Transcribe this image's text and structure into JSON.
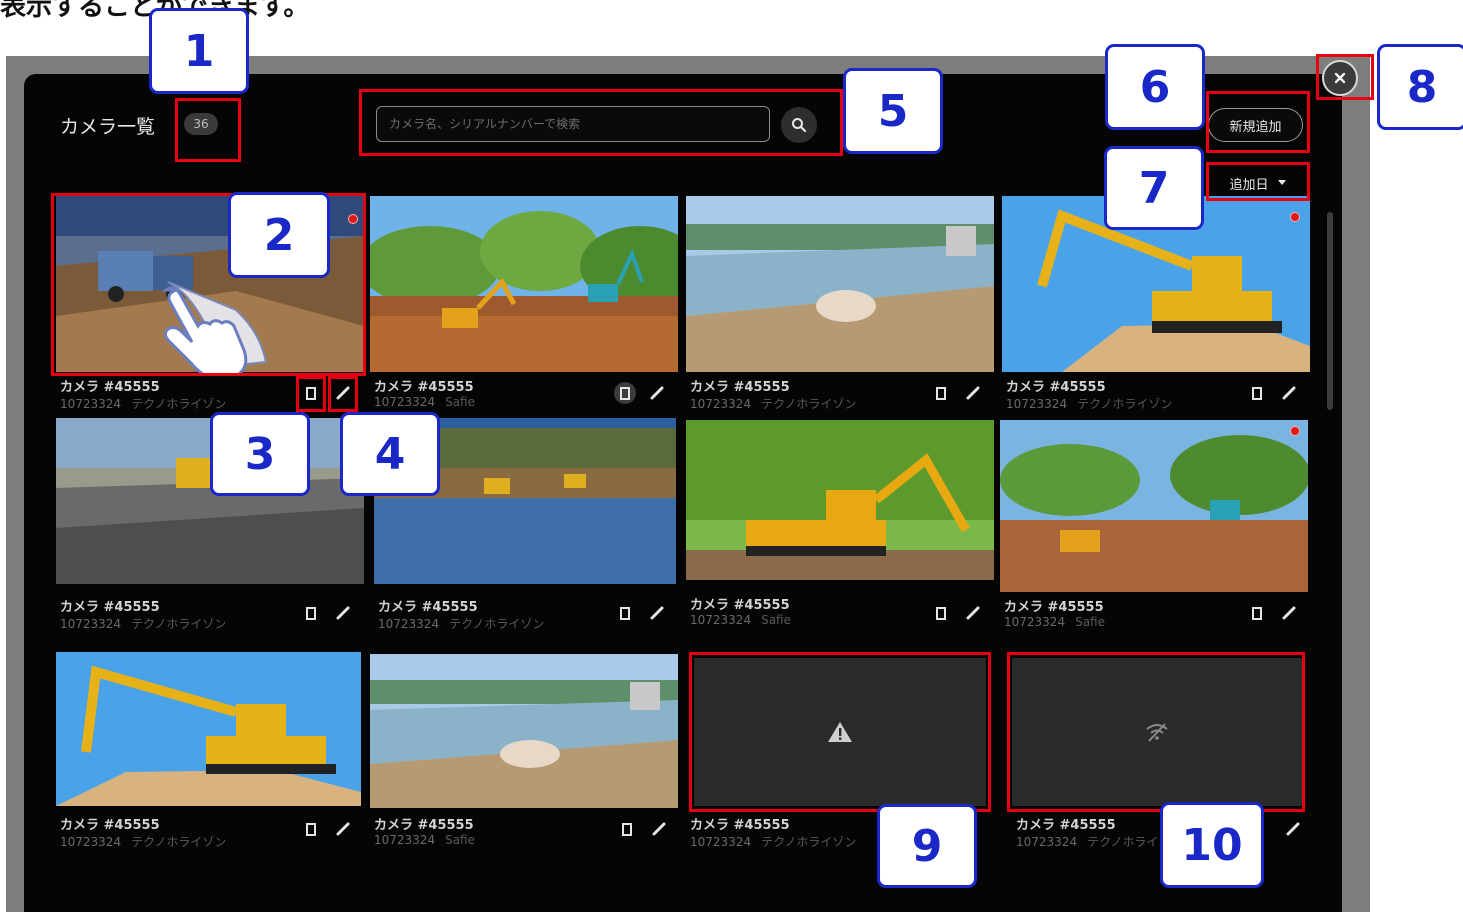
{
  "page_fragment": "表示することができます。",
  "header": {
    "title": "カメラ一覧",
    "count": "36",
    "search_placeholder": "カメラ名、シリアルナンバーで検索",
    "new_button": "新規追加",
    "sort_label": "追加日"
  },
  "cameras": [
    {
      "name": "カメラ #45555",
      "serial": "10723324",
      "source": "テクノホライゾン",
      "recording": true,
      "status": "image"
    },
    {
      "name": "カメラ #45555",
      "serial": "10723324",
      "source": "Safie",
      "recording": false,
      "status": "image"
    },
    {
      "name": "カメラ #45555",
      "serial": "10723324",
      "source": "テクノホライゾン",
      "recording": false,
      "status": "image"
    },
    {
      "name": "カメラ #45555",
      "serial": "10723324",
      "source": "テクノホライゾン",
      "recording": true,
      "status": "image"
    },
    {
      "name": "カメラ #45555",
      "serial": "10723324",
      "source": "テクノホライゾン",
      "recording": false,
      "status": "image"
    },
    {
      "name": "カメラ #45555",
      "serial": "10723324",
      "source": "テクノホライゾン",
      "recording": false,
      "status": "image"
    },
    {
      "name": "カメラ #45555",
      "serial": "10723324",
      "source": "Safie",
      "recording": false,
      "status": "image"
    },
    {
      "name": "カメラ #45555",
      "serial": "10723324",
      "source": "Safie",
      "recording": true,
      "status": "image"
    },
    {
      "name": "カメラ #45555",
      "serial": "10723324",
      "source": "テクノホライゾン",
      "recording": false,
      "status": "image"
    },
    {
      "name": "カメラ #45555",
      "serial": "10723324",
      "source": "Safie",
      "recording": false,
      "status": "image"
    },
    {
      "name": "カメラ #45555",
      "serial": "10723324",
      "source": "テクノホライゾン",
      "recording": false,
      "status": "error"
    },
    {
      "name": "カメラ #45555",
      "serial": "10723324",
      "source": "テクノホライゾン",
      "recording": false,
      "status": "offline"
    }
  ],
  "callouts": [
    "1",
    "2",
    "3",
    "4",
    "5",
    "6",
    "7",
    "8",
    "9",
    "10"
  ],
  "icons": {
    "search": "search-icon",
    "close": "close-icon",
    "sort": "caret-down-icon",
    "delete": "trash-icon",
    "edit": "pencil-icon",
    "error": "warning-icon",
    "offline": "wifi-off-icon",
    "pointer": "hand-pointer-icon"
  },
  "colors": {
    "modal_bg": "#050505",
    "backdrop": "#7d7d7d",
    "highlight": "#e60012",
    "callout": "#1a28c8",
    "recording": "#e01818",
    "placeholder_bg": "#2b2b2b"
  }
}
